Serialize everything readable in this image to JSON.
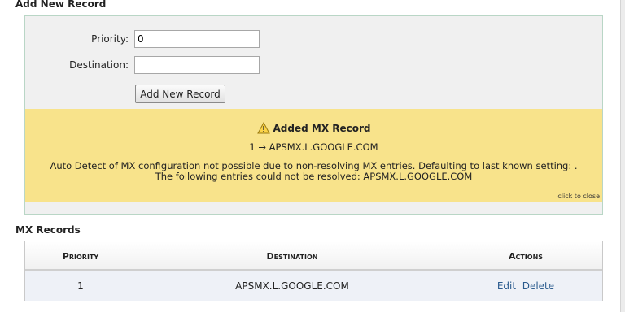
{
  "add_record": {
    "section_title": "Add New Record",
    "priority_label": "Priority:",
    "priority_value": "0",
    "destination_label": "Destination:",
    "destination_value": "",
    "submit_label": "Add New Record"
  },
  "notice": {
    "icon": "warning-icon",
    "title": "Added MX Record",
    "result_line": "1 → APSMX.L.GOOGLE.COM",
    "message_line1": "Auto Detect of MX configuration not possible due to non-resolving MX entries. Defaulting to last known setting: .",
    "message_line2": "The following entries could not be resolved: APSMX.L.GOOGLE.COM",
    "close_label": "click to close",
    "background_color": "#f8e38b"
  },
  "mx_records": {
    "section_title": "MX Records",
    "columns": [
      "Priority",
      "Destination",
      "Actions"
    ],
    "rows": [
      {
        "priority": "1",
        "destination": "APSMX.L.GOOGLE.COM",
        "edit_label": "Edit",
        "delete_label": "Delete"
      }
    ]
  },
  "colors": {
    "link": "#2a5b8e",
    "panel_background": "#f0f0f0",
    "panel_border": "#b9d6c6"
  }
}
